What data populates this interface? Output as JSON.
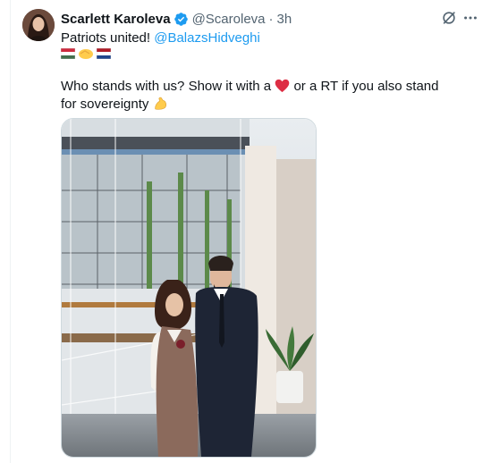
{
  "tweet": {
    "display_name": "Scarlett Karoleva",
    "handle": "@Scaroleva",
    "separator": "·",
    "time": "3h",
    "line1_text": "Patriots united! ",
    "mention": "@BalazsHidveghi",
    "body_text_a": "Who stands with us? Show it with a ",
    "body_text_b": " or a RT if you also stand for sovereignty ",
    "icons": [
      "verified-badge-icon",
      "grok-icon",
      "more-icon",
      "hungary-flag",
      "handshake",
      "netherlands-flag",
      "red-heart",
      "flexed-biceps"
    ],
    "colors": {
      "link": "#1d9bf0",
      "secondary": "#536471",
      "verified": "#1d9bf0",
      "heart": "#e0245e"
    }
  }
}
